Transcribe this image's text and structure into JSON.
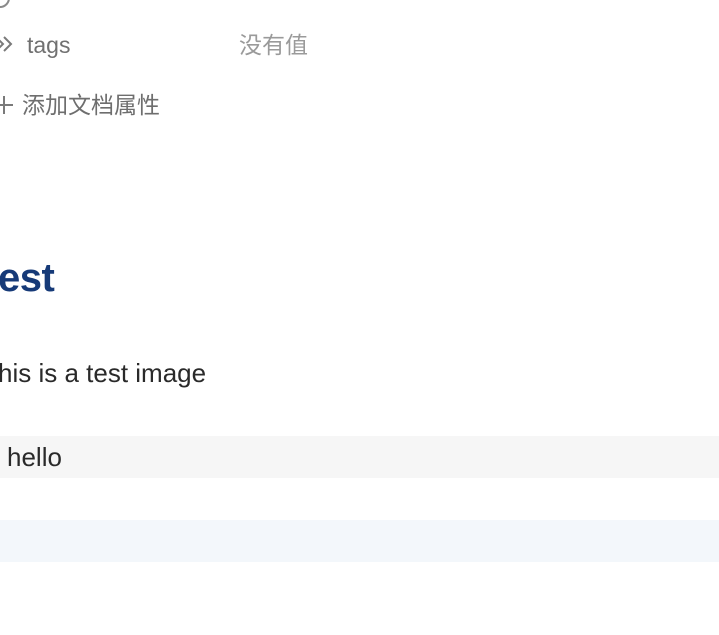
{
  "properties": {
    "tags": {
      "key": "tags",
      "value": "没有值",
      "icon": "tag-icon"
    },
    "add_label": "添加文档属性",
    "add_icon": "plus-icon"
  },
  "document": {
    "heading": "est",
    "paragraph": "his is a test image",
    "code_text": "hello"
  },
  "colors": {
    "heading": "#163a78",
    "code_background": "#f6f6f6",
    "empty_block_background": "#f3f7fb"
  }
}
